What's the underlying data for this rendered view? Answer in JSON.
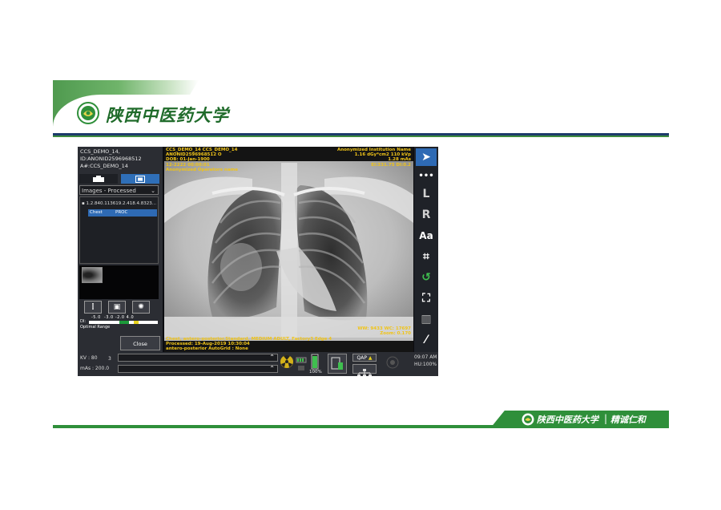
{
  "slide": {
    "header_title": "陕西中医药大学",
    "footer_title": "陕西中医药大学",
    "footer_motto": "精诚仁和",
    "colors": {
      "green": "#2f8f3a",
      "navy": "#1d3a6b"
    }
  },
  "patient": {
    "name": "CCS_DEMO_14,",
    "id": "ID:ANONID2596968512",
    "accession": "A#:CCS_DEMO_14"
  },
  "tabs": [
    {
      "icon": "camera-icon"
    },
    {
      "icon": "images-icon"
    }
  ],
  "image_filter": {
    "selected": "Images - Processed"
  },
  "series": {
    "uid": "1.2.840.113619.2.418.4.8323...",
    "item_label": "Chest",
    "item_status": "PROC"
  },
  "tool_buttons": [
    "patient-position-icon",
    "image-edit-icon",
    "exposure-settings-icon"
  ],
  "dose": {
    "scale": [
      "-5.0",
      "-3.0",
      "-2.0",
      "4.0"
    ],
    "di_label": "DI:",
    "range_label": "Optimal Range"
  },
  "close_label": "Close",
  "overlay": {
    "tl": [
      "CCS_DEMO_14 CCS_DEMO_14",
      "ANONID2596968512 O",
      "DOB: 01-Jan-1900",
      "12-2222  00:00:01",
      "Anonymized Operators name"
    ],
    "tr": [
      "Anonymized Institution Name",
      "1.16 dGy*cm2  110 kVp",
      "1.28 mAs",
      "EI:331.75 DI:0.2"
    ],
    "br": [
      "WW: 9433 WC: 17697",
      "Zoom: 0.170"
    ],
    "bl": [
      "Chest, antero-posterior,Standard, MEDIUM ADULT, Factory3 Edge 4",
      "Processed: 19-Aug-2019  10:30:04",
      "antero-posterior AutoGrid : None"
    ]
  },
  "right_toolbar": [
    {
      "label": "",
      "icon": "pointer-arrow-icon"
    },
    {
      "label": "•••",
      "icon": "more-icon"
    },
    {
      "label": "L",
      "icon": "left-marker-icon"
    },
    {
      "label": "R",
      "icon": "right-marker-icon"
    },
    {
      "label": "Aa",
      "icon": "text-annotation-icon"
    },
    {
      "label": "",
      "icon": "crop-icon"
    },
    {
      "label": "",
      "icon": "rotate-icon"
    },
    {
      "label": "",
      "icon": "patient-frame-icon"
    },
    {
      "label": "",
      "icon": "grid-icon"
    },
    {
      "label": "",
      "icon": "magic-wand-icon"
    }
  ],
  "bottom_bar": {
    "kv": "KV : 80",
    "kv_extra": "3",
    "mas": "mAs : 200.0",
    "battery": "100%",
    "qap": "QAP",
    "time": "09:07 AM",
    "hu": "HU:100%"
  }
}
